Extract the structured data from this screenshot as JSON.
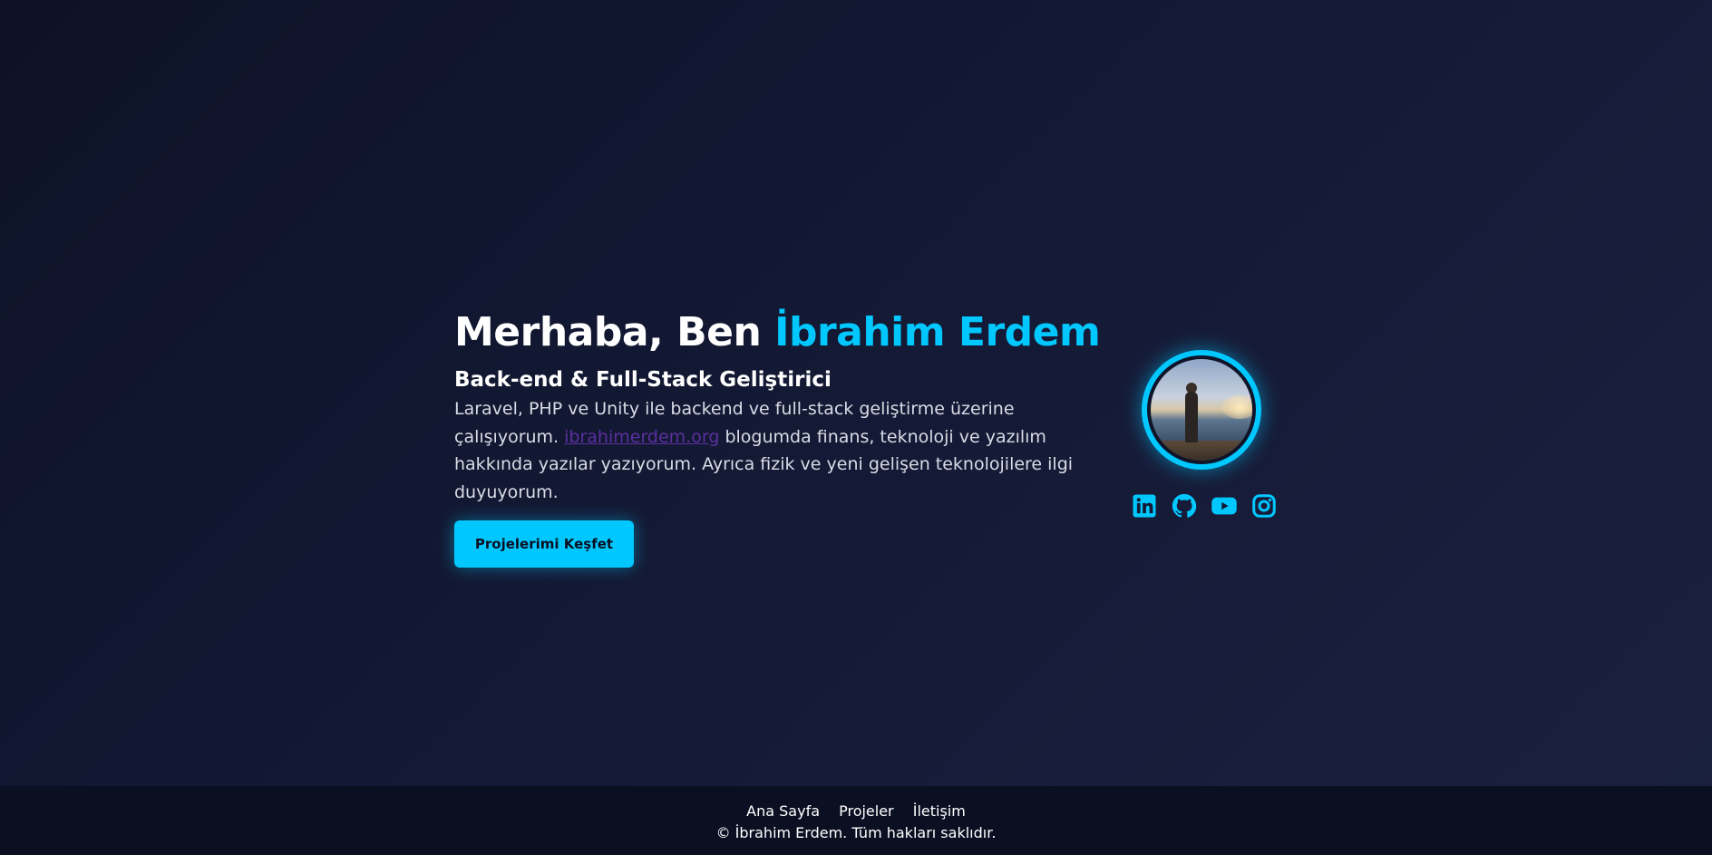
{
  "hero": {
    "greeting": "Merhaba, Ben ",
    "name": "İbrahim Erdem",
    "subtitle": "Back-end & Full-Stack Geliştirici",
    "description_part1": "Laravel, PHP ve Unity ile backend ve full-stack geliştirme üzerine çalışıyorum. ",
    "blog_link": "ibrahimerdem.org",
    "description_part2": " blogumda finans, teknoloji ve yazılım hakkında yazılar yazıyorum. Ayrıca fizik ve yeni gelişen teknolojilere ilgi duyuyorum.",
    "cta_label": "Projelerimi Keşfet"
  },
  "social": [
    {
      "icon": "linkedin-icon"
    },
    {
      "icon": "github-icon"
    },
    {
      "icon": "youtube-icon"
    },
    {
      "icon": "instagram-icon"
    }
  ],
  "footer": {
    "nav": [
      "Ana Sayfa",
      "Projeler",
      "İletişim"
    ],
    "copyright": "© İbrahim Erdem. Tüm hakları saklıdır."
  },
  "colors": {
    "accent": "#00c8ff",
    "background": "#141a35",
    "footer_bg": "#0b0f22",
    "link": "#5b2fa0"
  }
}
